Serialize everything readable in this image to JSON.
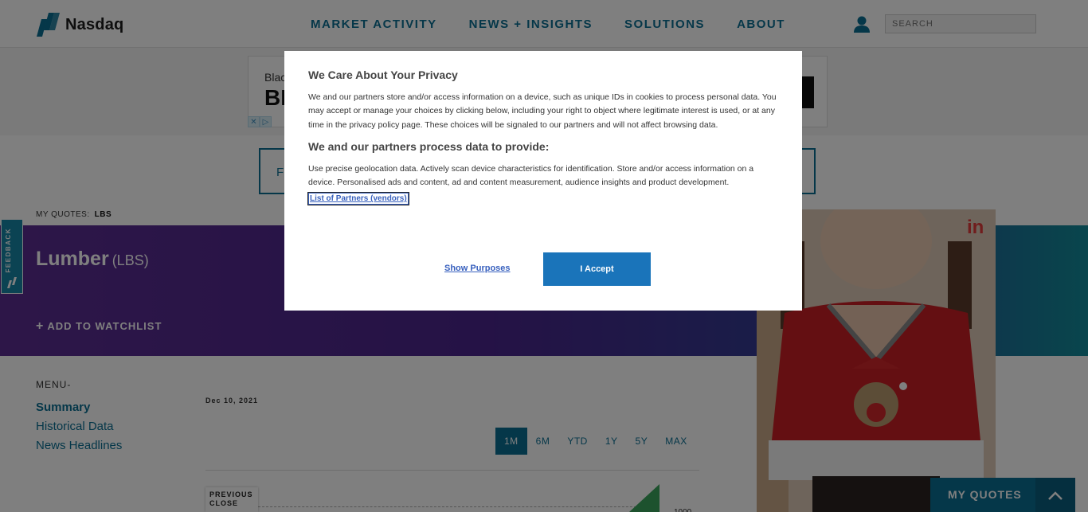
{
  "header": {
    "logo_text": "Nasdaq",
    "nav": [
      "MARKET ACTIVITY",
      "NEWS + INSIGHTS",
      "SOLUTIONS",
      "ABOUT"
    ],
    "search_placeholder": "SEARCH"
  },
  "ad_banner": {
    "line1": "Black",
    "line2": "BL"
  },
  "outline_box_text": "F",
  "my_quotes": {
    "label": "MY QUOTES:",
    "symbol": "LBS"
  },
  "feedback_label": "FEEDBACK",
  "hero": {
    "title": "Lumber",
    "symbol": "(LBS)",
    "add_watchlist": "ADD TO WATCHLIST"
  },
  "menu": {
    "label": "MENU-",
    "items": [
      "Summary",
      "Historical Data",
      "News Headlines"
    ]
  },
  "chart": {
    "date": "Dec 10, 2021",
    "ranges": [
      "1M",
      "6M",
      "YTD",
      "1Y",
      "5Y",
      "MAX"
    ],
    "selected_range": "1M",
    "previous_close_label": "PREVIOUS CLOSE",
    "tick_value": "1000"
  },
  "my_quotes_bar": "MY QUOTES",
  "privacy_modal": {
    "title": "We Care About Your Privacy",
    "body": "We and our partners store and/or access information on a device, such as unique IDs in cookies to process personal data. You may accept or manage your choices by clicking below, including your right to object where legitimate interest is used, or at any time in the privacy policy page. These choices will be signaled to our partners and will not affect browsing data.",
    "subtitle": "We and our partners process data to provide:",
    "purposes": "Use precise geolocation data. Actively scan device characteristics for identification. Store and/or access information on a device. Personalised ads and content, ad and content measurement, audience insights and product development.",
    "vendors_link": "List of Partners (vendors)",
    "show_purposes": "Show Purposes",
    "accept": "I Accept"
  },
  "colors": {
    "brand_teal": "#0b6f93",
    "accept_blue": "#1a74ba",
    "link_blue": "#3860be"
  }
}
